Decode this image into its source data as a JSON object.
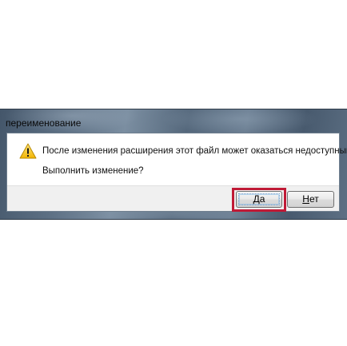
{
  "dialog": {
    "title": "переименование",
    "message": "После изменения расширения этот файл может оказаться недоступным.",
    "question": "Выполнить изменение?",
    "icon": "warning-icon",
    "buttons": {
      "yes_label": "Да",
      "no_label": "Нет"
    },
    "highlight_color": "#c01a36"
  }
}
